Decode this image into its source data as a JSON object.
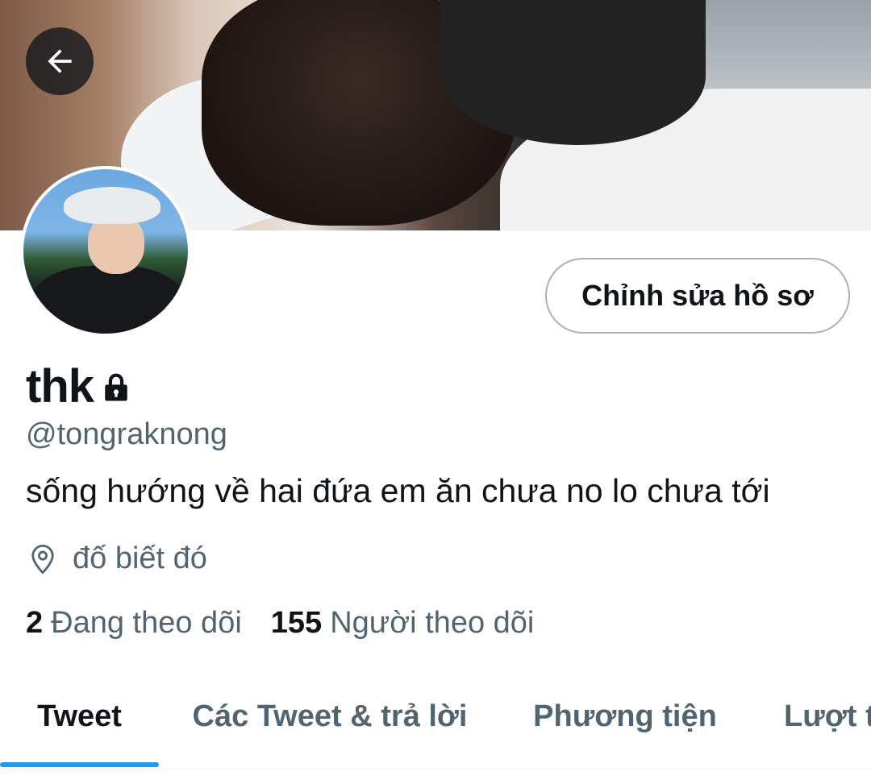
{
  "header": {
    "back_icon": "arrow-left-icon"
  },
  "profile": {
    "edit_button_label": "Chỉnh sửa hồ sơ",
    "display_name": "thk",
    "protected_icon": "lock-icon",
    "handle": "@tongraknong",
    "bio": "sống hướng về hai đứa em ăn chưa no lo chưa tới",
    "location_icon": "map-pin-icon",
    "location": "đố biết đó",
    "following_count": "2",
    "following_label": "Đang theo dõi",
    "followers_count": "155",
    "followers_label": "Người theo dõi"
  },
  "tabs": [
    {
      "label": "Tweet",
      "active": true
    },
    {
      "label": "Các Tweet & trả lời",
      "active": false
    },
    {
      "label": "Phương tiện",
      "active": false
    },
    {
      "label": "Lượt thích",
      "active": false
    }
  ],
  "colors": {
    "accent": "#1d9bf0",
    "text_primary": "#0f1419",
    "text_secondary": "#536471",
    "button_border": "#a7b1b9"
  }
}
